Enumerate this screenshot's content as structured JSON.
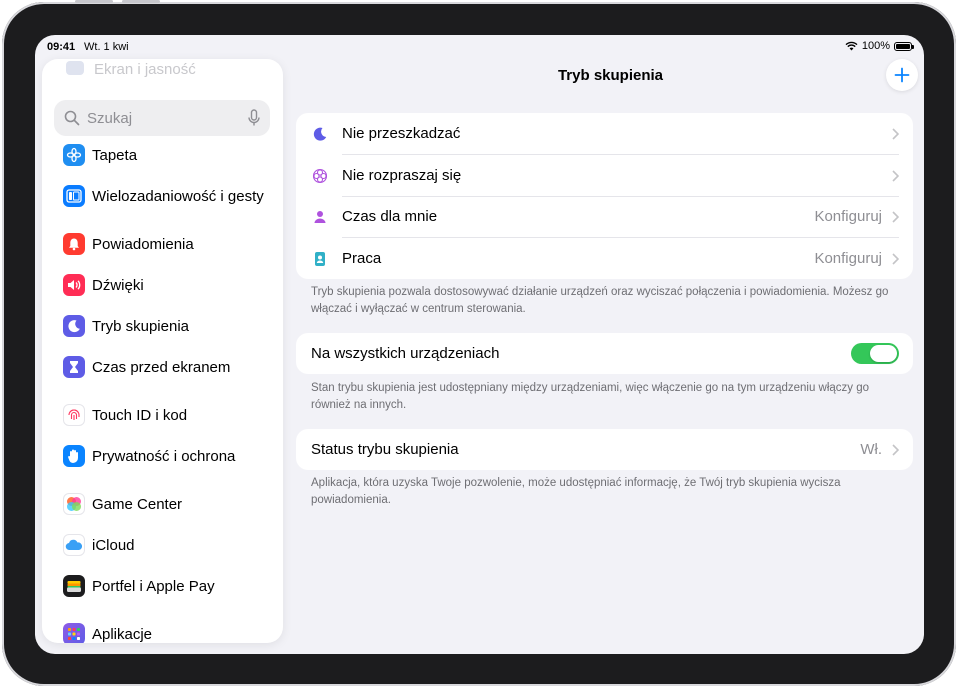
{
  "status_bar": {
    "time": "09:41",
    "date": "Wt. 1 kwi",
    "battery": "100%"
  },
  "sidebar": {
    "faded_item": "Ekran i jasność",
    "search_placeholder": "Szukaj",
    "items": [
      {
        "label": "Tapeta",
        "icon": "flower-icon",
        "color": "#1f8ef1"
      },
      {
        "label": "Wielozadaniowość i gesty",
        "icon": "multitasking-icon",
        "color": "#0a7cff"
      },
      {
        "label": "Powiadomienia",
        "icon": "bell-icon",
        "color": "#ff3b30"
      },
      {
        "label": "Dźwięki",
        "icon": "speaker-icon",
        "color": "#ff2d55"
      },
      {
        "label": "Tryb skupienia",
        "icon": "moon-icon",
        "color": "#5e5ce6"
      },
      {
        "label": "Czas przed ekranem",
        "icon": "hourglass-icon",
        "color": "#5e5ce6"
      },
      {
        "label": "Touch ID i kod",
        "icon": "fingerprint-icon",
        "color": "#ffffff"
      },
      {
        "label": "Prywatność i ochrona",
        "icon": "hand-icon",
        "color": "#0a84ff"
      },
      {
        "label": "Game Center",
        "icon": "game-center-icon",
        "color": "#ffffff"
      },
      {
        "label": "iCloud",
        "icon": "cloud-icon",
        "color": "#ffffff"
      },
      {
        "label": "Portfel i Apple Pay",
        "icon": "wallet-icon",
        "color": "#1c1c1e"
      },
      {
        "label": "Aplikacje",
        "icon": "apps-grid-icon",
        "color": "#6e5ce6"
      }
    ]
  },
  "main": {
    "title": "Tryb skupienia",
    "focus_modes": [
      {
        "label": "Nie przeszkadzać",
        "value": "",
        "icon": "moon-icon",
        "color": "#5e5ce6"
      },
      {
        "label": "Nie rozpraszaj się",
        "value": "",
        "icon": "mindfulness-icon",
        "color": "#af52de"
      },
      {
        "label": "Czas dla mnie",
        "value": "Konfiguruj",
        "icon": "person-icon",
        "color": "#af52de"
      },
      {
        "label": "Praca",
        "value": "Konfiguruj",
        "icon": "badge-icon",
        "color": "#30b0c7"
      }
    ],
    "focus_note": "Tryb skupienia pozwala dostosowywać działanie urządzeń oraz wyciszać połączenia i powiadomienia. Możesz go włączać i wyłączać w centrum sterowania.",
    "share_across_devices": {
      "label": "Na wszystkich urządzeniach",
      "on": true
    },
    "share_note": "Stan trybu skupienia jest udostępniany między urządzeniami, więc włączenie go na tym urządzeniu włączy go również na innych.",
    "focus_status": {
      "label": "Status trybu skupienia",
      "value": "Wł."
    },
    "status_note": "Aplikacja, która uzyska Twoje pozwolenie, może udostępniać informację, że Twój tryb skupienia wycisza powiadomienia."
  }
}
